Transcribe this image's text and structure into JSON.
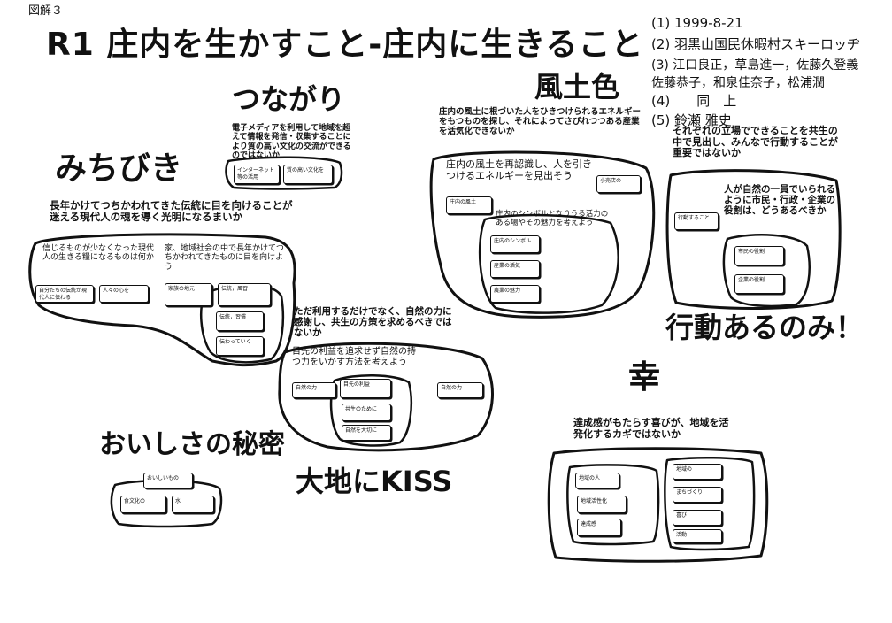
{
  "figure_label": "図解３",
  "title": "R1 庄内を生かすこと-庄内に生きること",
  "info": {
    "date": "(1) 1999-8-21",
    "venue": "(2) 羽黒山国民休暇村スキーロッヂ",
    "members_1": "(3) 江口良正，草島進一，佐藤久登義",
    "members_2": "佐藤恭子，和泉佳奈子，松浦潤",
    "same": "(4)　　同　上",
    "facilitator": "(5) 鈴瀬 雅史"
  },
  "groups": {
    "tsunagari": {
      "heading": "つながり",
      "phrase": "電子メディアを利用して地域を超えて情報を発信・収集することにより質の高い文化の交流ができるのではないか",
      "card_1": "インターネット等の活用",
      "card_2": "質の高い文化を"
    },
    "michibiki": {
      "heading": "みちびき",
      "phrase": "長年かけてつちかわれてきた伝統に目を向けることが迷える現代人の魂を導く光明になるまいか",
      "sub_1": "信じるものが少なくなった現代人の生きる糧になるものは何か",
      "sub_2": "家、地域社会の中で長年かけてつちかわれてきたものに目を向けよう",
      "card_1": "自分たちの伝統が現代人に伝わる",
      "card_2": "人々の心を",
      "card_3": "家族の地元",
      "card_4": "伝統，風習",
      "card_5": "伝統，習慣",
      "card_6": "伝わっていく"
    },
    "fudoshoku": {
      "heading": "風土色",
      "phrase": "庄内の風土に根づいた人をひきつけられるエネルギーをもつものを探し、それによってさびれつつある産業を活気化できないか",
      "sub_1": "庄内の風土を再認識し、人を引きつけるエネルギーを見出そう",
      "sub_2": "庄内のシンボルとなりうる活力のある場やその魅力を考えよう",
      "card_1": "庄内の風土",
      "card_2": "小売店の",
      "card_3": "庄内のシンボル",
      "card_4": "産業の活気",
      "card_5": "農業の魅力"
    },
    "kodo": {
      "heading": "行動あるのみ！",
      "phrase": "それぞれの立場でできることを共生の中で見出し、みんなで行動することが重要ではないか",
      "sub_1": "人が自然の一員でいられるように市民・行政・企業の役割は、どうあるべきか",
      "card_1": "行動すること",
      "card_2": "市民の役割",
      "card_3": "企業の役割"
    },
    "daichi": {
      "heading": "大地にKISS",
      "phrase": "ただ利用するだけでなく、自然の力に感謝し、共生の方策を求めるべきではないか",
      "sub_1": "目先の利益を追求せず自然の持つ力をいかす方法を考えよう",
      "card_1": "自然の力",
      "card_2": "目先の利益",
      "card_3": "共生のために",
      "card_4": "自然を大切に",
      "card_5": "自然の力"
    },
    "oishisa": {
      "heading": "おいしさの秘密",
      "card_1": "おいしいもの",
      "card_2": "食文化の",
      "card_3": "水"
    },
    "sachi": {
      "heading": "幸",
      "phrase": "達成感がもたらす喜びが、地域を活発化するカギではないか",
      "card_1": "地域の人",
      "card_2": "地域活性化",
      "card_3": "達成感",
      "card_4": "地域の",
      "card_5": "まちづくり",
      "card_6": "喜び",
      "card_7": "活動"
    }
  }
}
